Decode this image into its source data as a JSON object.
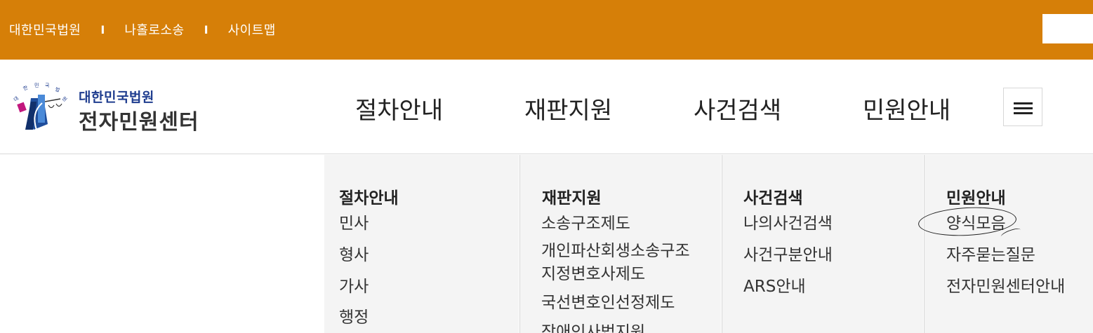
{
  "topbar": {
    "links": [
      "대한민국법원",
      "나홀로소송",
      "사이트맵"
    ],
    "separator": "I"
  },
  "logo": {
    "emblem_text": "대 한 민 국 법 원",
    "sub": "대한민국법원",
    "main": "전자민원센터"
  },
  "nav": {
    "items": [
      "절차안내",
      "재판지원",
      "사건검색",
      "민원안내"
    ]
  },
  "menu_button": {
    "icon": "hamburger-icon"
  },
  "dropdown": {
    "columns": [
      {
        "title": "절차안내",
        "links": [
          "민사",
          "형사",
          "가사",
          "행정"
        ]
      },
      {
        "title": "재판지원",
        "links": [
          "소송구조제도",
          "개인파산회생소송구조",
          "지정변호사제도",
          "국선변호인선정제도",
          "장애인사법지원"
        ]
      },
      {
        "title": "사건검색",
        "links": [
          "나의사건검색",
          "사건구분안내",
          "ARS안내"
        ]
      },
      {
        "title": "민원안내",
        "links": [
          "양식모음",
          "자주묻는질문",
          "전자민원센터안내"
        ]
      }
    ]
  },
  "colors": {
    "topbar": "#d67f08",
    "logo_blue": "#1f3d8f",
    "panel_bg": "#f4f4f4"
  }
}
